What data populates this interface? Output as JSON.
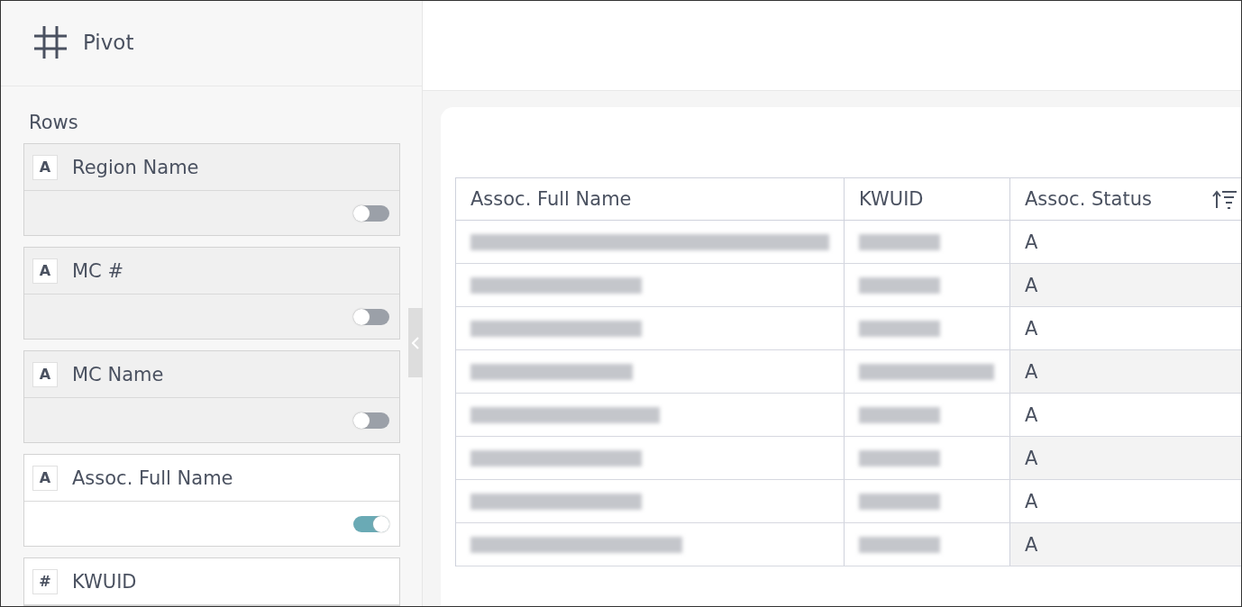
{
  "panel": {
    "title": "Pivot",
    "section": "Rows",
    "fields": [
      {
        "glyph": "A",
        "label": "Region Name",
        "on": false
      },
      {
        "glyph": "A",
        "label": "MC #",
        "on": false
      },
      {
        "glyph": "A",
        "label": "MC Name",
        "on": false
      },
      {
        "glyph": "A",
        "label": "Assoc. Full Name",
        "on": true
      },
      {
        "glyph": "#",
        "label": "KWUID"
      }
    ]
  },
  "table": {
    "columns": [
      {
        "label": "Assoc. Full Name",
        "sortable": false
      },
      {
        "label": "KWUID",
        "sortable": false
      },
      {
        "label": "Assoc. Status",
        "sortable": true
      }
    ],
    "rows": [
      {
        "status": "A"
      },
      {
        "status": "A"
      },
      {
        "status": "A"
      },
      {
        "status": "A"
      },
      {
        "status": "A"
      },
      {
        "status": "A"
      },
      {
        "status": "A"
      },
      {
        "status": "A"
      }
    ]
  }
}
